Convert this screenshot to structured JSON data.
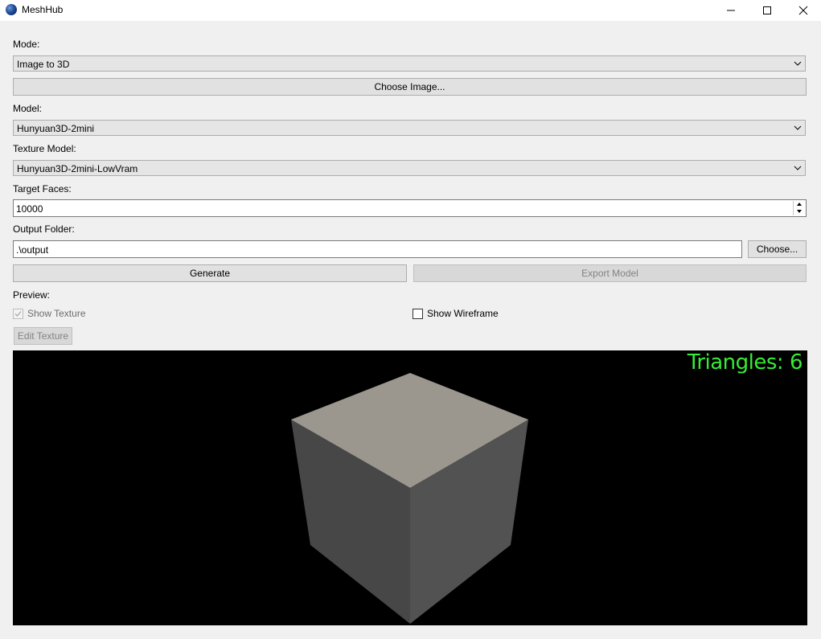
{
  "window": {
    "title": "MeshHub",
    "icon": "globe-app-icon"
  },
  "mode": {
    "label": "Mode:",
    "selected": "Image to 3D"
  },
  "choose_image_button": "Choose Image...",
  "model": {
    "label": "Model:",
    "selected": "Hunyuan3D-2mini"
  },
  "texture_model": {
    "label": "Texture Model:",
    "selected": "Hunyuan3D-2mini-LowVram"
  },
  "target_faces": {
    "label": "Target Faces:",
    "value": "10000"
  },
  "output_folder": {
    "label": "Output Folder:",
    "value": ".\\output",
    "choose_button": "Choose..."
  },
  "actions": {
    "generate": "Generate",
    "export": "Export Model"
  },
  "preview": {
    "label": "Preview:",
    "show_texture": "Show Texture",
    "show_texture_checked": true,
    "show_wireframe": "Show Wireframe",
    "show_wireframe_checked": false,
    "edit_texture": "Edit Texture",
    "triangles_text": "Triangles: 6"
  },
  "colors": {
    "viewport_bg": "#000000",
    "overlay_text": "#37ea37",
    "cube_top": "#9b978f",
    "cube_left": "#474747",
    "cube_right": "#525252"
  }
}
